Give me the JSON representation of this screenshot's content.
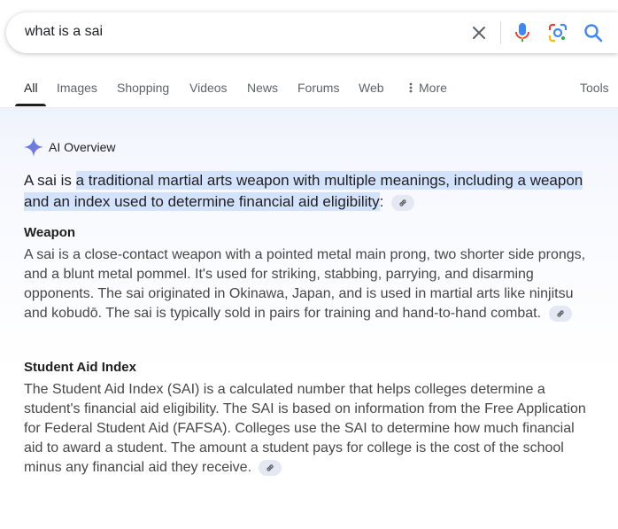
{
  "search": {
    "query": "what is a sai"
  },
  "tabs": [
    {
      "label": "All"
    },
    {
      "label": "Images"
    },
    {
      "label": "Shopping"
    },
    {
      "label": "Videos"
    },
    {
      "label": "News"
    },
    {
      "label": "Forums"
    },
    {
      "label": "Web"
    },
    {
      "label": "More"
    }
  ],
  "tools_label": "Tools",
  "overview": {
    "label": "AI Overview",
    "lead_prefix": "A sai is ",
    "lead_highlight": "a traditional martial arts weapon with multiple meanings, including a weapon and an index used to determine financial aid eligibility",
    "lead_suffix": ":",
    "sections": [
      {
        "title": "Weapon",
        "body": "A sai is a close-contact weapon with a pointed metal main prong, two shorter side prongs, and a blunt metal pommel. It's used for striking, stabbing, parrying, and disarming opponents. The sai originated in Okinawa, Japan, and is used in martial arts like ninjitsu and kobudō. The sai is typically sold in pairs for training and hand-to-hand combat."
      },
      {
        "title": "Student Aid Index",
        "body": "The Student Aid Index (SAI) is a calculated number that helps colleges determine a student's financial aid eligibility. The SAI is based on information from the Free Application for Federal Student Aid (FAFSA). Colleges use the SAI to determine how much financial aid to award a student. The amount a student pays for college is the cost of the school minus any financial aid they receive."
      }
    ]
  },
  "colors": {
    "highlight": "#d3e3fd",
    "mic_blue": "#4285f4",
    "mic_red": "#ea4335",
    "lens_yellow": "#fbbc04",
    "lens_green": "#34a853"
  }
}
